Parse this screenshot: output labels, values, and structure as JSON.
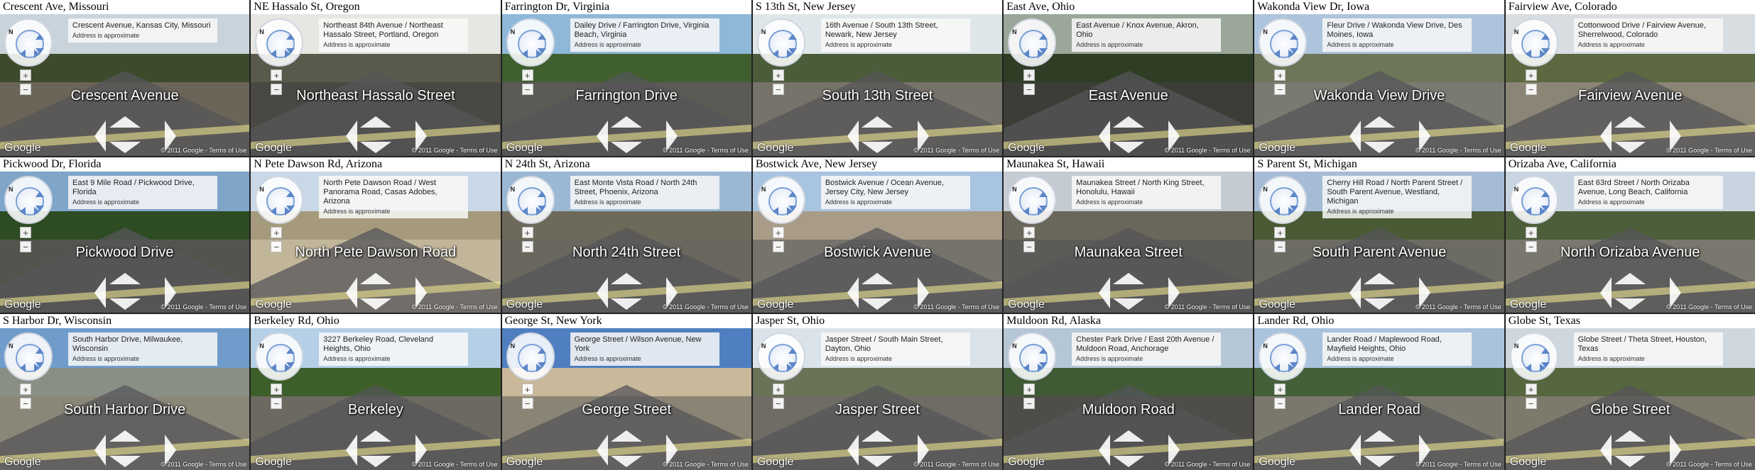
{
  "footer": {
    "logo": "Google",
    "copyright": "© 2011 Google - Terms of Use",
    "approx": "Address is approximate"
  },
  "tiles": [
    {
      "title": "Crescent Ave, Missouri",
      "address": "Crescent Avenue, Kansas City, Missouri",
      "street": "Crescent Avenue",
      "sky": "#c9d3dc",
      "trees": "#3d4a2c",
      "ground": "#6b6558"
    },
    {
      "title": "NE Hassalo St, Oregon",
      "address": "Northeast 84th Avenue / Northeast Hassalo Street, Portland, Oregon",
      "street": "Northeast Hassalo Street",
      "sky": "#e6e6e2",
      "trees": "#5a5a4c",
      "ground": "#4a4844"
    },
    {
      "title": "Farrington Dr, Virginia",
      "address": "Dailey Drive / Farrington Drive, Virginia Beach, Virginia",
      "street": "Farrington Drive",
      "sky": "#8fb8d8",
      "trees": "#3f5f2f",
      "ground": "#5b5a55"
    },
    {
      "title": "S 13th St, New Jersey",
      "address": "16th Avenue / South 13th Street, Newark, New Jersey",
      "street": "South 13th Street",
      "sky": "#dfe6ea",
      "trees": "#4b5c3a",
      "ground": "#77736a"
    },
    {
      "title": "East Ave, Ohio",
      "address": "East Avenue / Knox Avenue, Akron, Ohio",
      "street": "East Avenue",
      "sky": "#9aa79a",
      "trees": "#2f3d25",
      "ground": "#3c3d36"
    },
    {
      "title": "Wakonda View Dr, Iowa",
      "address": "Fleur Drive / Wakonda View Drive, Des Moines, Iowa",
      "street": "Wakonda View Drive",
      "sky": "#aec4dc",
      "trees": "#6d7658",
      "ground": "#7a7a72"
    },
    {
      "title": "Fairview Ave, Colorado",
      "address": "Cottonwood Drive / Fairview Avenue, Sherrelwood, Colorado",
      "street": "Fairview Avenue",
      "sky": "#d8dde2",
      "trees": "#5c6840",
      "ground": "#8a8574"
    },
    {
      "title": "Pickwood Dr, Florida",
      "address": "East 9 Mile Road / Pickwood Drive, Florida",
      "street": "Pickwood Drive",
      "sky": "#7fa5c9",
      "trees": "#2e4c24",
      "ground": "#54544e"
    },
    {
      "title": "N Pete Dawson Rd, Arizona",
      "address": "North Pete Dawson Road / West Panorama Road, Casas Adobes, Arizona",
      "street": "North Pete Dawson Road",
      "sky": "#c9d8e6",
      "trees": "#a59a7c",
      "ground": "#c2b69a"
    },
    {
      "title": "N 24th St, Arizona",
      "address": "East Monte Vista Road / North 24th Street, Phoenix, Arizona",
      "street": "North 24th Street",
      "sky": "#9ab8d4",
      "trees": "#6e6a5a",
      "ground": "#6a675f"
    },
    {
      "title": "Bostwick Ave, New Jersey",
      "address": "Bostwick Avenue / Ocean Avenue, Jersey City, New Jersey",
      "street": "Bostwick Avenue",
      "sky": "#a8c4e0",
      "trees": "#a89c88",
      "ground": "#75736c"
    },
    {
      "title": "Maunakea St, Hawaii",
      "address": "Maunakea Street / North King Street, Honolulu, Hawaii",
      "street": "Maunakea Street",
      "sky": "#c4cbd2",
      "trees": "#6b665a",
      "ground": "#5c5b57"
    },
    {
      "title": "S Parent St, Michigan",
      "address": "Cherry Hill Road / North Parent Street / South Parent Avenue, Westland, Michigan",
      "street": "South Parent Avenue",
      "sky": "#a6bcd6",
      "trees": "#4a5a34",
      "ground": "#6d6c64"
    },
    {
      "title": "Orizaba Ave, California",
      "address": "East 63rd Street / North Orizaba Avenue, Long Beach, California",
      "street": "North Orizaba Avenue",
      "sky": "#c8d5e0",
      "trees": "#4d5e3a",
      "ground": "#7a776e"
    },
    {
      "title": "S Harbor Dr, Wisconsin",
      "address": "South Harbor Drive, Milwaukee, Wisconsin",
      "street": "South Harbor Drive",
      "sky": "#6f9ccb",
      "trees": "#8a8f86",
      "ground": "#8a8778"
    },
    {
      "title": "Berkeley Rd, Ohio",
      "address": "3227 Berkeley Road, Cleveland Heights, Ohio",
      "street": "Berkeley",
      "sky": "#b4cfe6",
      "trees": "#3d5f2a",
      "ground": "#6c6a60"
    },
    {
      "title": "George St, New York",
      "address": "George Street / Wilson Avenue, New York",
      "street": "George Street",
      "sky": "#4f7fc0",
      "trees": "#c9b89a",
      "ground": "#8a8474"
    },
    {
      "title": "Jasper St, Ohio",
      "address": "Jasper Street / South Main Street, Dayton, Ohio",
      "street": "Jasper Street",
      "sky": "#dbe3ea",
      "trees": "#6a7258",
      "ground": "#6e6c64"
    },
    {
      "title": "Muldoon Rd, Alaska",
      "address": "Chester Park Drive / East 20th Avenue / Muldoon Road, Anchorage",
      "street": "Muldoon Road",
      "sky": "#b5c6d6",
      "trees": "#3f5a34",
      "ground": "#4e4d49"
    },
    {
      "title": "Lander Rd, Ohio",
      "address": "Lander Road / Maplewood Road, Mayfield Heights, Ohio",
      "street": "Lander Road",
      "sky": "#a9c3dc",
      "trees": "#44603a",
      "ground": "#7a786d"
    },
    {
      "title": "Globe St, Texas",
      "address": "Globe Street / Theta Street, Houston, Texas",
      "street": "Globe Street",
      "sky": "#cfd7de",
      "trees": "#56663e",
      "ground": "#7d7a6c"
    }
  ]
}
